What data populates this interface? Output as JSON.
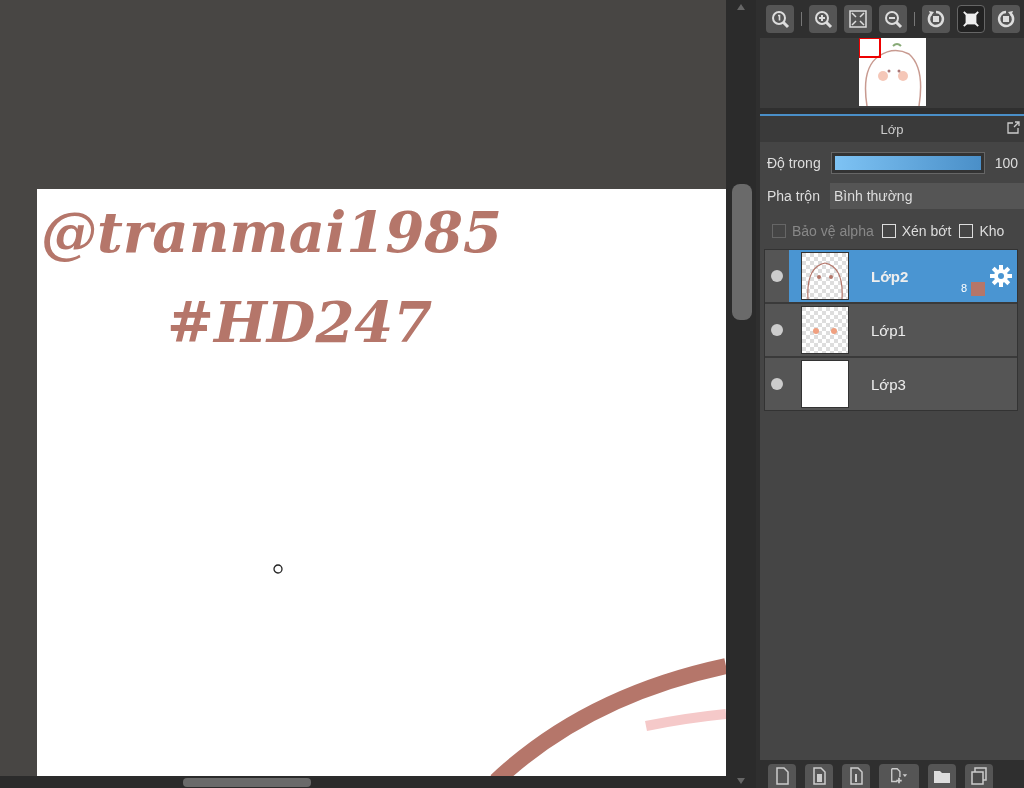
{
  "canvas": {
    "handwriting": [
      "@tranmai1985",
      "#HD247"
    ]
  },
  "toolbar": [
    {
      "kind": "zoom-actual"
    },
    {
      "kind": "zoom-in"
    },
    {
      "kind": "fit"
    },
    {
      "kind": "zoom-out"
    },
    {
      "kind": "rotate-left"
    },
    {
      "kind": "fullscreen",
      "selected": true
    },
    {
      "kind": "rotate-right"
    }
  ],
  "layers_panel": {
    "title": "Lớp",
    "opacity": {
      "label": "Độ trong",
      "level": 1,
      "reading": "100"
    },
    "blend": {
      "label": "Pha trộn",
      "value": "Bình thường"
    },
    "options": [
      {
        "label": "Bảo vệ alpha",
        "checked": false,
        "disabled": true
      },
      {
        "label": "Xén bớt",
        "checked": false,
        "disabled": false
      },
      {
        "label": "Kho",
        "checked": false,
        "disabled": false
      }
    ],
    "layers": [
      {
        "name": "Lớp2",
        "selected": true,
        "transparent": true,
        "badge": "8",
        "color": "#b5766a"
      },
      {
        "name": "Lớp1",
        "selected": false,
        "transparent": true
      },
      {
        "name": "Lớp3",
        "selected": false,
        "transparent": false
      }
    ],
    "bottom_tools": [
      {
        "kind": "new-layer"
      },
      {
        "kind": "new-8bit"
      },
      {
        "kind": "new-1bit"
      },
      {
        "kind": "add-menu"
      },
      {
        "kind": "folder"
      },
      {
        "kind": "duplicate"
      }
    ]
  }
}
